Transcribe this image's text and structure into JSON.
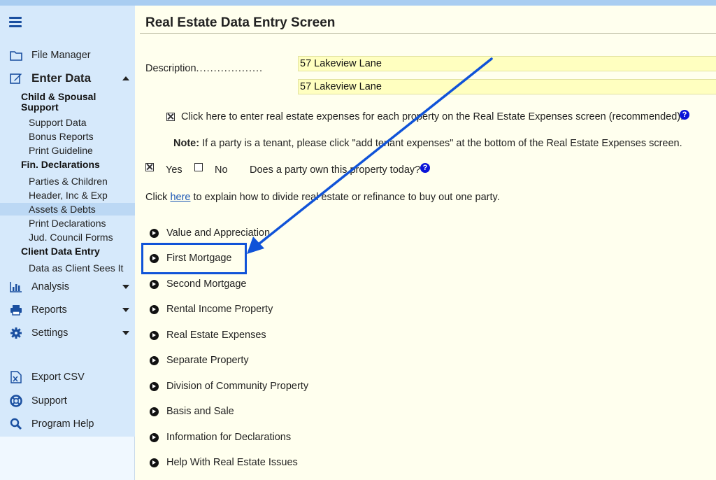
{
  "sidebar": {
    "menu_icon": "hamburger-icon",
    "file_manager": "File Manager",
    "enter_data": "Enter Data",
    "groups": {
      "child_spousal": "Child & Spousal Support",
      "fin_declarations": "Fin. Declarations",
      "client_data_entry": "Client Data Entry"
    },
    "child_items": [
      "Support Data",
      "Bonus Reports",
      "Print Guideline"
    ],
    "fin_items": [
      "Parties & Children",
      "Header, Inc & Exp",
      "Assets & Debts",
      "Print Declarations",
      "Jud. Council Forms"
    ],
    "client_items": [
      "Data as Client Sees It"
    ],
    "analysis": "Analysis",
    "reports": "Reports",
    "settings": "Settings",
    "export_csv": "Export CSV",
    "support": "Support",
    "program_help": "Program Help"
  },
  "main": {
    "title": "Real Estate Data Entry Screen",
    "description_label": "Description",
    "description_dots": "...................",
    "description_line1": "57 Lakeview Lane",
    "description_line2": "57 Lakeview Lane",
    "expenses_checkbox_text": "Click here to enter real estate expenses for each property on the Real Estate Expenses screen (recommended).",
    "note_label": "Note:",
    "note_text": "If a party is a tenant, please click \"add tenant expenses\" at the bottom of the Real Estate Expenses screen.",
    "yes_label": "Yes",
    "no_label": "No",
    "own_question": "Does a party own this property today?",
    "help_glyph": "?",
    "click_prefix": "Click",
    "click_link": "here",
    "click_suffix": "to explain how to divide real estate or refinance to buy out one party.",
    "sections": [
      "Value and Appreciation",
      "First Mortgage",
      "Second Mortgage",
      "Rental Income Property",
      "Real Estate Expenses",
      "Separate Property",
      "Division of Community Property",
      "Basis and Sale",
      "Information for Declarations",
      "Help With Real Estate Issues"
    ]
  },
  "colors": {
    "accent": "#1053d8",
    "sidebar_bg": "#d6e9fb",
    "main_bg": "#ffffee",
    "input_bg": "#ffffc0",
    "help_icon": "#0a14d8"
  }
}
